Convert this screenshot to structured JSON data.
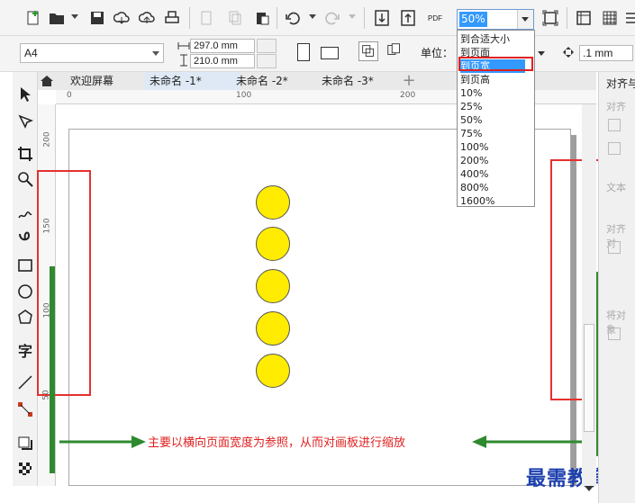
{
  "toolbar": {
    "zoom_value": "50%",
    "pdf_label": "PDF"
  },
  "property_bar": {
    "page_size": "A4",
    "width": "297.0 mm",
    "height": "210.0 mm",
    "unit_label": "单位：",
    "nudge": ".1 mm"
  },
  "zoom_options": [
    "到合适大小",
    "到页面",
    "到页宽",
    "到页高",
    "10%",
    "25%",
    "50%",
    "75%",
    "100%",
    "200%",
    "400%",
    "800%",
    "1600%"
  ],
  "zoom_selected_index": 2,
  "tabs": [
    "欢迎屏幕",
    "未命名 -1*",
    "未命名 -2*",
    "未命名 -3*"
  ],
  "ruler_top_ticks": [
    "0",
    "100",
    "200"
  ],
  "ruler_left_ticks": [
    "200",
    "150",
    "100",
    "50"
  ],
  "docker": {
    "title": "对齐与",
    "items": [
      "对齐",
      "文本",
      "对齐对",
      "将对象"
    ]
  },
  "annotation": {
    "caption": "主要以横向页面宽度为参照，从而对画板进行缩放"
  },
  "watermark": "最需教育",
  "colors": {
    "highlight": "#e02020",
    "arrow_green": "#2f8a2f",
    "circle_fill": "#ffec00",
    "selection_blue": "#3399ff"
  }
}
